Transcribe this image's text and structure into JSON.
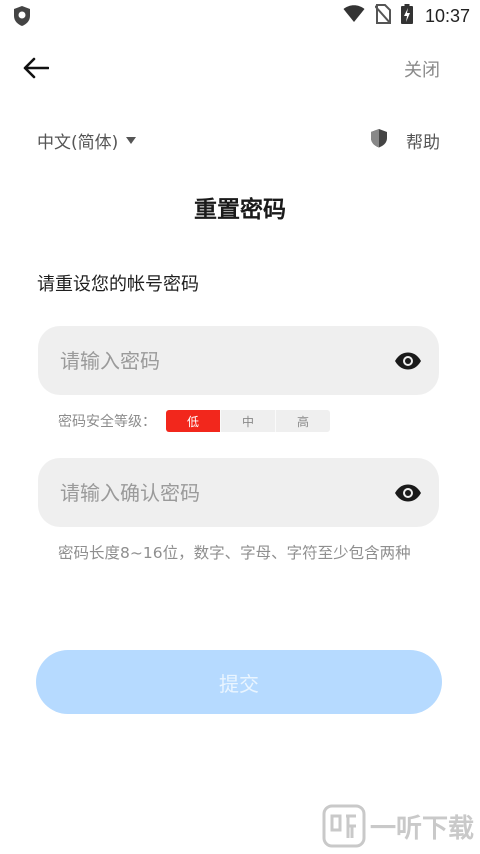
{
  "status_bar": {
    "time": "10:37"
  },
  "header": {
    "close_label": "关闭"
  },
  "language": {
    "selected": "中文(简体)"
  },
  "help": {
    "label": "帮助"
  },
  "page": {
    "title": "重置密码",
    "subtitle": "请重设您的帐号密码"
  },
  "password_field": {
    "placeholder": "请输入密码",
    "value": ""
  },
  "strength": {
    "label": "密码安全等级：",
    "levels": [
      "低",
      "中",
      "高"
    ],
    "current": "低"
  },
  "confirm_field": {
    "placeholder": "请输入确认密码",
    "value": ""
  },
  "hint": "密码长度8~16位，数字、字母、字符至少包含两种",
  "submit_label": "提交",
  "watermark_text": "一听下载",
  "colors": {
    "accent_disabled": "#b6daff",
    "strength_low": "#f2271c"
  }
}
